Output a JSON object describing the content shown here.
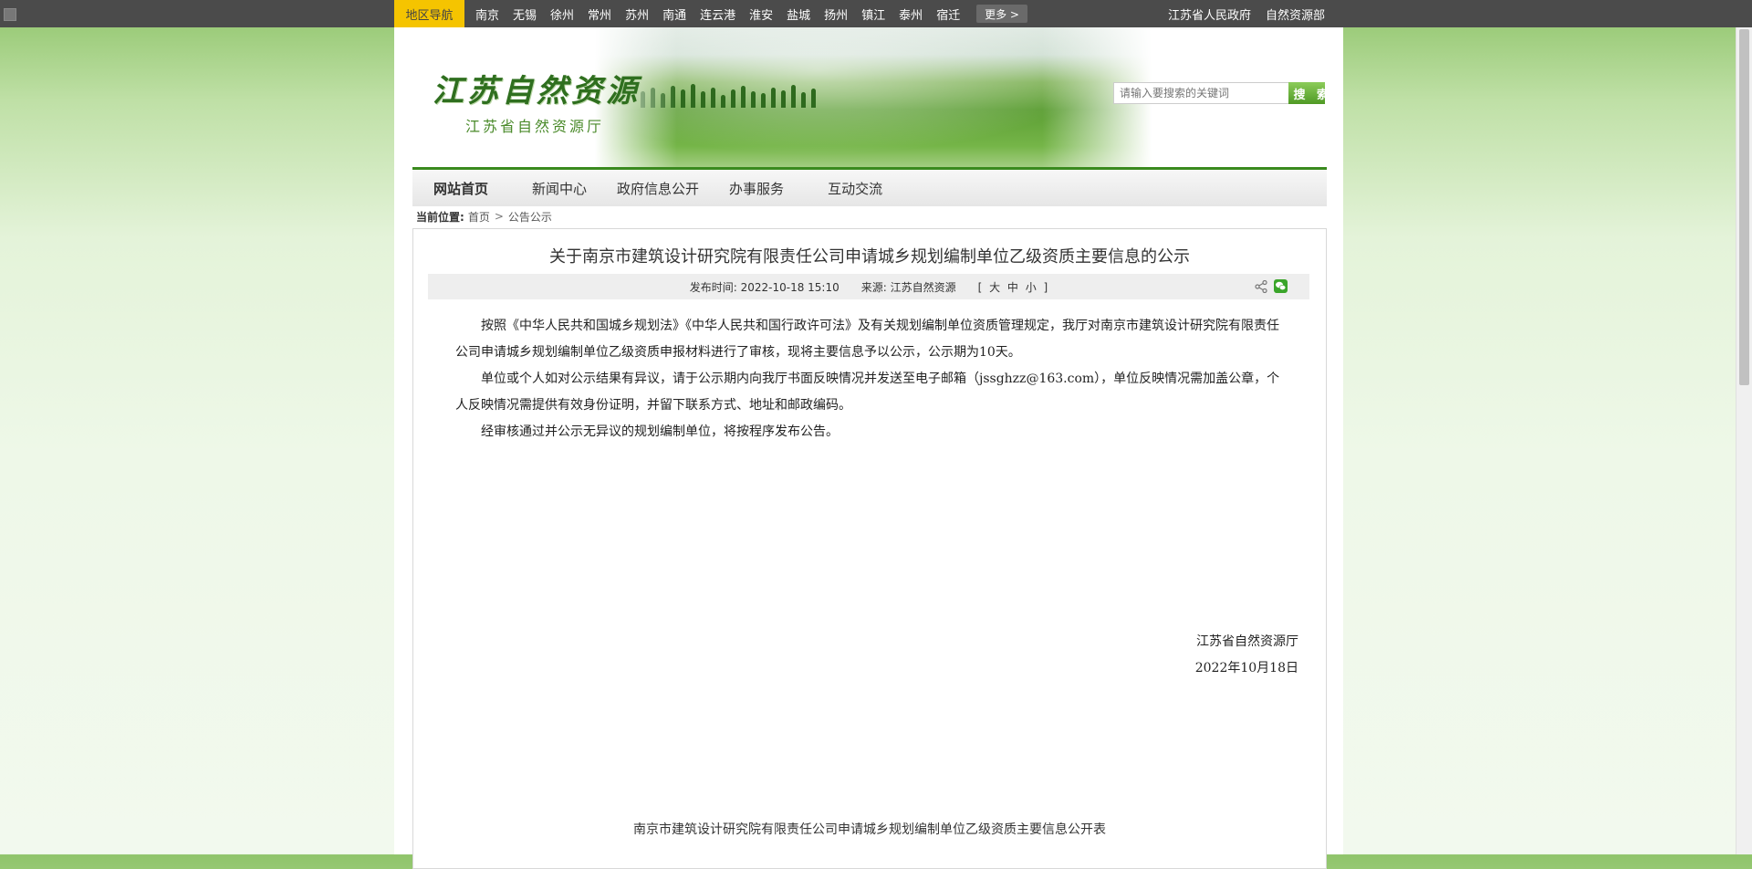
{
  "topbar": {
    "region_label": "地区导航",
    "cities": [
      "南京",
      "无锡",
      "徐州",
      "常州",
      "苏州",
      "南通",
      "连云港",
      "淮安",
      "盐城",
      "扬州",
      "镇江",
      "泰州",
      "宿迁"
    ],
    "more_label": "更多 >",
    "right_links": [
      "江苏省人民政府",
      "自然资源部"
    ]
  },
  "header": {
    "logo_main": "江苏自然资源",
    "logo_sub": "江苏省自然资源厅",
    "search_placeholder": "请输入要搜索的关键词",
    "search_button": "搜 索"
  },
  "nav": {
    "items": [
      "网站首页",
      "新闻中心",
      "政府信息公开",
      "办事服务",
      "互动交流"
    ]
  },
  "breadcrumb": {
    "label": "当前位置:",
    "home": "首页",
    "separator": ">",
    "current": "公告公示"
  },
  "article": {
    "title": "关于南京市建筑设计研究院有限责任公司申请城乡规划编制单位乙级资质主要信息的公示",
    "publish_time": "发布时间: 2022-10-18 15:10",
    "source": "来源: 江苏自然资源",
    "font_size_switch": "[ 大  中  小 ]",
    "paragraphs": [
      "按照《中华人民共和国城乡规划法》《中华人民共和国行政许可法》及有关规划编制单位资质管理规定，我厅对南京市建筑设计研究院有限责任公司申请城乡规划编制单位乙级资质申报材料进行了审核，现将主要信息予以公示，公示期为10天。",
      "单位或个人如对公示结果有异议，请于公示期内向我厅书面反映情况并发送至电子邮箱（jssghzz@163.com），单位反映情况需加盖公章，个人反映情况需提供有效身份证明，并留下联系方式、地址和邮政编码。",
      "经审核通过并公示无异议的规划编制单位，将按程序发布公告。"
    ],
    "signature": "江苏省自然资源厅",
    "date": "2022年10月18日",
    "table_title": "南京市建筑设计研究院有限责任公司申请城乡规划编制单位乙级资质主要信息公开表"
  },
  "colors": {
    "accent_green": "#3a8a1e",
    "topbar_bg": "#4b4b4b",
    "region_yellow": "#f5c400"
  }
}
